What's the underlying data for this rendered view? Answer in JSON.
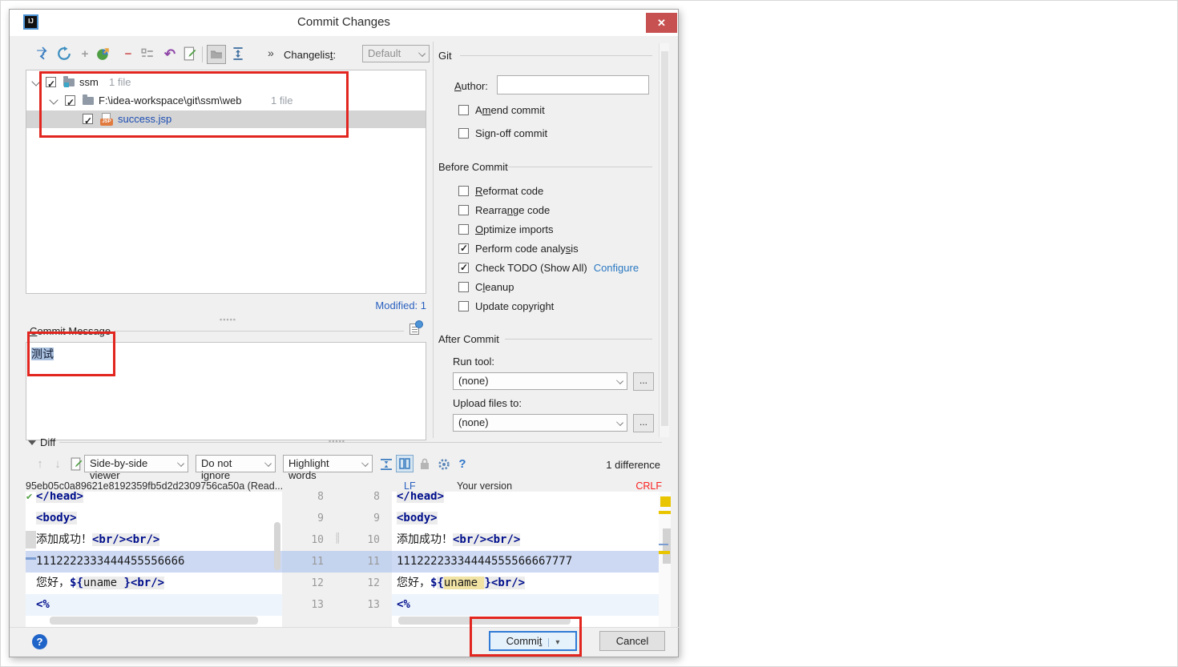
{
  "colors": {
    "annotation_red": "#e2261f",
    "titlebar_close_red": "#c75050",
    "focus_blue": "#2f7bd6",
    "link_blue": "#2a78c2",
    "modified_file_blue": "#1b4db3",
    "selection_blue": "#cdd9f3",
    "word_highlight_yellow": "#f1e3a3"
  },
  "window": {
    "title": "Commit Changes",
    "logo": "IJ",
    "close": "✕"
  },
  "toolbar": {
    "icons": [
      "show-diff",
      "refresh",
      "add",
      "move-to-changelist",
      "remove",
      "changelist-group",
      "rollback",
      "edit-source",
      "group-by-directory",
      "expand-all"
    ],
    "overflow": "»",
    "changelist_label": {
      "text": "Changelist:",
      "u": 9
    },
    "changelist_value": "Default"
  },
  "tree": {
    "rows": [
      {
        "name": "ssm",
        "meta": "1 file"
      },
      {
        "name": "F:\\idea-workspace\\git\\ssm\\web",
        "meta": "1 file"
      },
      {
        "name": "success.jsp",
        "meta": ""
      }
    ],
    "modified": "Modified: 1"
  },
  "git": {
    "section": "Git",
    "author_label": {
      "text": "Author:",
      "u": 0
    },
    "author_value": "",
    "amend": {
      "text": "Amend commit",
      "u": 1
    },
    "signoff": {
      "text": "Sign-off commit",
      "u": 2
    }
  },
  "before": {
    "section": "Before Commit",
    "items": [
      {
        "label": "Reformat code",
        "u": 0,
        "checked": false
      },
      {
        "label": "Rearrange code",
        "u": 6,
        "checked": false
      },
      {
        "label": "Optimize imports",
        "u": 0,
        "checked": false
      },
      {
        "label": "Perform code analysis",
        "u": 18,
        "checked": true
      },
      {
        "label": "Check TODO (Show All)",
        "u": -1,
        "checked": true,
        "link": "Configure"
      },
      {
        "label": "Cleanup",
        "u": 1,
        "checked": false
      },
      {
        "label": "Update copyright",
        "u": -1,
        "checked": false
      }
    ]
  },
  "after": {
    "section": "After Commit",
    "run_label": "Run tool:",
    "run_value": "(none)",
    "upload_label": "Upload files to:",
    "upload_value": "(none)",
    "browse": "..."
  },
  "commit_message": {
    "label": {
      "text": "Commit Message",
      "u": 0
    },
    "value": "测试"
  },
  "diff": {
    "header": "Diff",
    "viewer_combo": "Side-by-side viewer",
    "ignore_combo": "Do not ignore",
    "highlight_combo": "Highlight words",
    "differences": "1 difference",
    "left_title": "95eb05c0a89621e8192359fb5d2d2309756ca50a (Read...",
    "left_separator": "LF",
    "right_title": "Your version",
    "right_separator": "CRLF",
    "rows": [
      {
        "n": "8",
        "cut": true,
        "marker": "check",
        "row": "",
        "left": [
          {
            "t": "</head>",
            "c": "tag"
          }
        ],
        "right": [
          {
            "t": "</head>",
            "c": "tag"
          }
        ]
      },
      {
        "n": "9",
        "row": "",
        "left": [
          {
            "t": "<body>",
            "c": "tag"
          }
        ],
        "right": [
          {
            "t": "<body>",
            "c": "tag"
          }
        ]
      },
      {
        "n": "10",
        "marker": "block",
        "row": "",
        "left": [
          {
            "t": "添加成功！",
            "c": "txt"
          },
          {
            "t": "<br/>",
            "c": "tag"
          },
          {
            "t": "<br/>",
            "c": "tag"
          }
        ],
        "right": [
          {
            "t": "添加成功！",
            "c": "txt"
          },
          {
            "t": "<br/>",
            "c": "tag"
          },
          {
            "t": "<br/>",
            "c": "tag"
          }
        ]
      },
      {
        "n": "11",
        "marker": "dash",
        "row": "sel",
        "left": [
          {
            "t": "1112222333444455556666",
            "c": "txt"
          }
        ],
        "right": [
          {
            "t": "11122223334444555566667777",
            "c": "txt"
          }
        ]
      },
      {
        "n": "12",
        "row": "",
        "left": [
          {
            "t": "您好，",
            "c": "txt"
          },
          {
            "t": "$",
            "c": "kw"
          },
          {
            "t": "{",
            "c": "tag"
          },
          {
            "t": "uname ",
            "c": "attr"
          },
          {
            "t": "}",
            "c": "tag"
          },
          {
            "t": "<br/>",
            "c": "tag"
          }
        ],
        "right": [
          {
            "t": "您好，",
            "c": "txt"
          },
          {
            "t": "$",
            "c": "kw"
          },
          {
            "t": "{",
            "c": "tag"
          },
          {
            "t": "uname ",
            "c": "hl"
          },
          {
            "t": "}",
            "c": "tag"
          },
          {
            "t": "<br/>",
            "c": "tag"
          }
        ]
      },
      {
        "n": "13",
        "row": "faint",
        "left": [
          {
            "t": "<%",
            "c": "kw"
          }
        ],
        "right": [
          {
            "t": "<%",
            "c": "kw"
          }
        ]
      }
    ]
  },
  "footer": {
    "help": "?",
    "commit": {
      "text": "Commit",
      "u": 5
    },
    "commit_arrow": "▾",
    "cancel": "Cancel"
  }
}
